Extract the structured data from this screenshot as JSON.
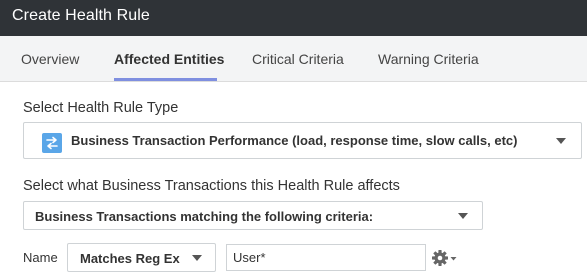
{
  "window": {
    "title": "Create Health Rule"
  },
  "tabs": [
    {
      "label": "Overview"
    },
    {
      "label": "Affected Entities"
    },
    {
      "label": "Critical Criteria"
    },
    {
      "label": "Warning Criteria"
    }
  ],
  "health_rule_type": {
    "label": "Select Health Rule Type",
    "selected": "Business Transaction Performance (load, response time, slow calls, etc)",
    "icon": "business-transaction-icon"
  },
  "affects": {
    "label": "Select what Business Transactions this Health Rule affects",
    "selected": "Business Transactions matching the following criteria:"
  },
  "name_criteria": {
    "label": "Name",
    "match_type": "Matches Reg Ex",
    "value": "User*",
    "gear_icon": "gear-icon"
  },
  "colors": {
    "titlebar_bg": "#2f3337",
    "tab_accent": "#7f8fe0",
    "icon_blue": "#5aa6e8"
  }
}
